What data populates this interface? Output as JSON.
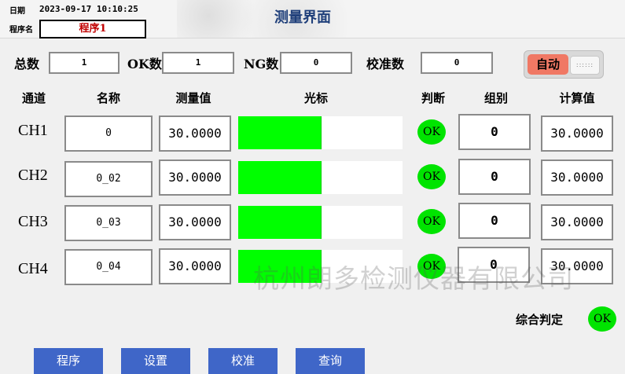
{
  "header": {
    "date_label": "日期",
    "datetime": "2023-09-17  10:10:25",
    "program_label": "程序名",
    "program_name": "程序1",
    "title": "测量界面"
  },
  "stats": {
    "total_label": "总数",
    "total_value": "1",
    "ok_label": "OK数",
    "ok_value": "1",
    "ng_label": "NG数",
    "ng_value": "0",
    "calib_label": "校准数",
    "calib_value": "0"
  },
  "mode_toggle": {
    "label": "自动",
    "state": "on",
    "grip": "::::::"
  },
  "columns": {
    "channel": "通道",
    "name": "名称",
    "measured": "测量值",
    "cursor": "光标",
    "judge": "判断",
    "group": "组别",
    "computed": "计算值"
  },
  "rows": [
    {
      "channel": "CH1",
      "name": "0",
      "measured": "30.0000",
      "bar_fraction": 0.5,
      "judge": "OK",
      "group": "0",
      "computed": "30.0000"
    },
    {
      "channel": "CH2",
      "name": "0_02",
      "measured": "30.0000",
      "bar_fraction": 0.5,
      "judge": "OK",
      "group": "0",
      "computed": "30.0000"
    },
    {
      "channel": "CH3",
      "name": "0_03",
      "measured": "30.0000",
      "bar_fraction": 0.5,
      "judge": "OK",
      "group": "0",
      "computed": "30.0000"
    },
    {
      "channel": "CH4",
      "name": "0_04",
      "measured": "30.0000",
      "bar_fraction": 0.5,
      "judge": "OK",
      "group": "0",
      "computed": "30.0000"
    }
  ],
  "summary": {
    "label": "综合判定",
    "result": "OK"
  },
  "nav": {
    "program": "程序",
    "settings": "设置",
    "calibrate": "校准",
    "query": "查询"
  },
  "watermark": "杭州朗多检测仪器有限公司",
  "colors": {
    "ok_led": "#00e400",
    "bar_fill": "#00ff00",
    "nav_button": "#3f66c8",
    "title": "#1f3f7a",
    "auto_toggle": "#f07864"
  }
}
